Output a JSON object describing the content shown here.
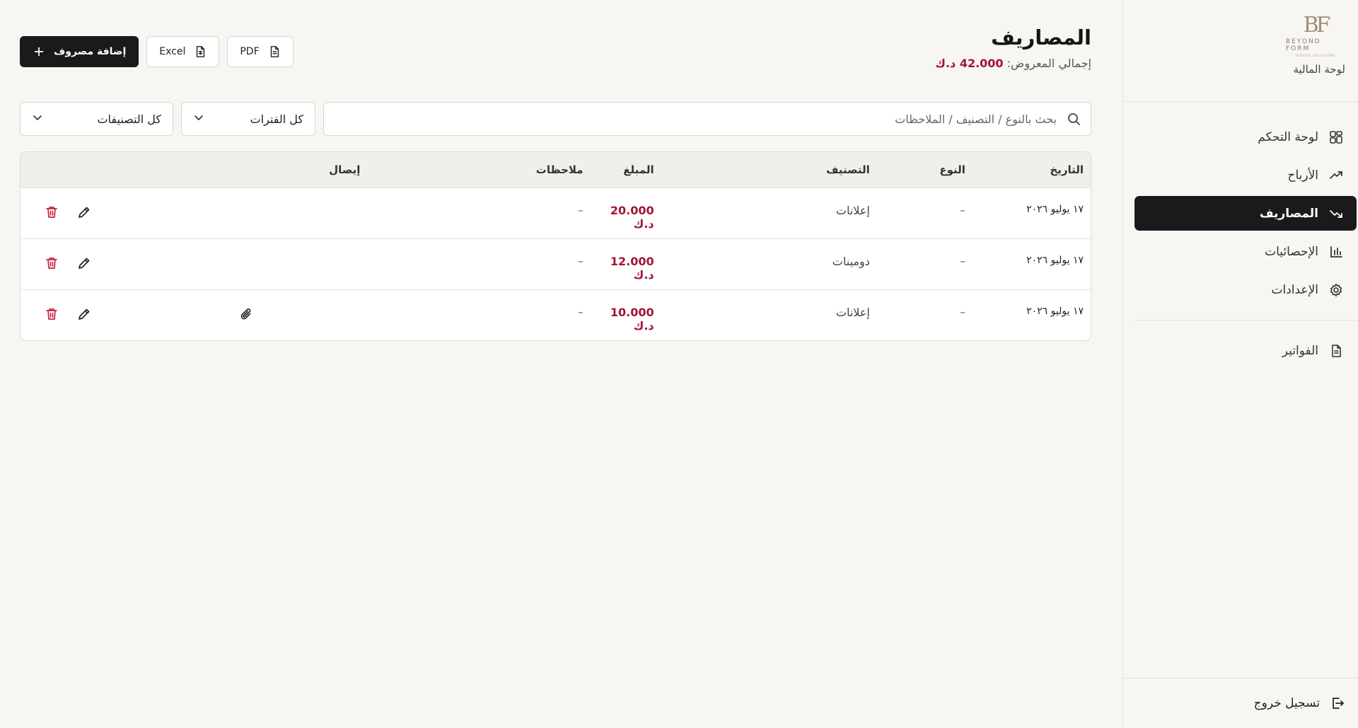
{
  "brand": {
    "logo_mark": "BF",
    "logo_word": "BEYOND FORM",
    "logo_sub": "DIGITAL SOLUTIONS",
    "title": "لوحة المالية"
  },
  "nav": {
    "items": [
      {
        "label": "لوحة التحكم",
        "icon": "grid-icon",
        "active": false
      },
      {
        "label": "الأرباح",
        "icon": "trending-up-icon",
        "active": false
      },
      {
        "label": "المصاريف",
        "icon": "trending-down-icon",
        "active": true
      },
      {
        "label": "الإحصائيات",
        "icon": "bar-chart-icon",
        "active": false
      },
      {
        "label": "الإعدادات",
        "icon": "gear-icon",
        "active": false
      }
    ],
    "secondary": [
      {
        "label": "الفواتير",
        "icon": "document-icon"
      }
    ],
    "logout_label": "تسجيل خروج"
  },
  "header": {
    "title": "المصاريف",
    "total_label": "إجمالي المعروض:",
    "total_value": "42.000 د.ك",
    "buttons": {
      "pdf": "PDF",
      "excel": "Excel",
      "add": "إضافة مصروف"
    }
  },
  "filters": {
    "search_placeholder": "بحث بالنوع / التصنيف / الملاحظات",
    "period_value": "كل الفترات",
    "category_value": "كل التصنيفات"
  },
  "table": {
    "columns": [
      "التاريخ",
      "النوع",
      "التصنيف",
      "المبلغ",
      "ملاحظات",
      "إيصال"
    ],
    "rows": [
      {
        "date": "١٧ يوليو ٢٠٢٦",
        "type": "–",
        "category": "إعلانات",
        "amount": "20.000 د.ك",
        "notes": "–",
        "receipt": false
      },
      {
        "date": "١٧ يوليو ٢٠٢٦",
        "type": "–",
        "category": "دومينات",
        "amount": "12.000 د.ك",
        "notes": "–",
        "receipt": false
      },
      {
        "date": "١٧ يوليو ٢٠٢٦",
        "type": "–",
        "category": "إعلانات",
        "amount": "10.000 د.ك",
        "notes": "–",
        "receipt": true
      }
    ]
  },
  "colors": {
    "accent": "#a01535",
    "dark": "#1a1a1c",
    "background": "#f7f6f3"
  }
}
